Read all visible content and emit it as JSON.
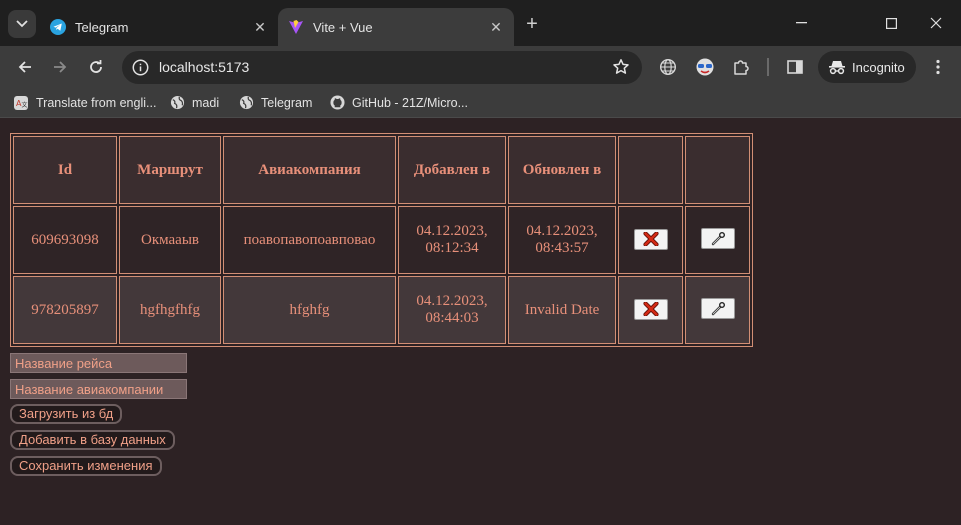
{
  "browser": {
    "tabs": [
      {
        "title": "Telegram",
        "icon": "telegram-icon"
      },
      {
        "title": "Vite + Vue",
        "icon": "vite-icon"
      }
    ],
    "url": "localhost:5173",
    "incognito_label": "Incognito",
    "bookmarks": [
      {
        "label": "Translate from engli...",
        "icon": "translate-icon"
      },
      {
        "label": "madi",
        "icon": "globe-icon"
      },
      {
        "label": "Telegram",
        "icon": "globe-icon"
      },
      {
        "label": "GitHub - 21Z/Micro...",
        "icon": "github-icon"
      }
    ]
  },
  "table": {
    "headers": [
      "Id",
      "Маршрут",
      "Авиакомпания",
      "Добавлен в",
      "Обновлен в",
      "",
      ""
    ],
    "rows": [
      {
        "id": "609693098",
        "route": "Окмааыв",
        "airline": "поавопавопоавповао",
        "added": "04.12.2023, 08:12:34",
        "updated": "04.12.2023, 08:43:57"
      },
      {
        "id": "978205897",
        "route": "hgfhgfhfg",
        "airline": "hfghfg",
        "added": "04.12.2023, 08:44:03",
        "updated": "Invalid Date"
      }
    ],
    "delete_icon": "x-icon",
    "edit_icon": "wrench-icon"
  },
  "form": {
    "flight_placeholder": "Название рейса",
    "airline_placeholder": "Название авиакомпании",
    "load_button": "Загрузить из бд",
    "add_button": "Добавить в базу данных",
    "save_button": "Сохранить изменения"
  },
  "colors": {
    "page_bg": "#2d2224",
    "accent_text": "#e8907a",
    "border": "#d28f75",
    "delete_red": "#d42a14"
  }
}
